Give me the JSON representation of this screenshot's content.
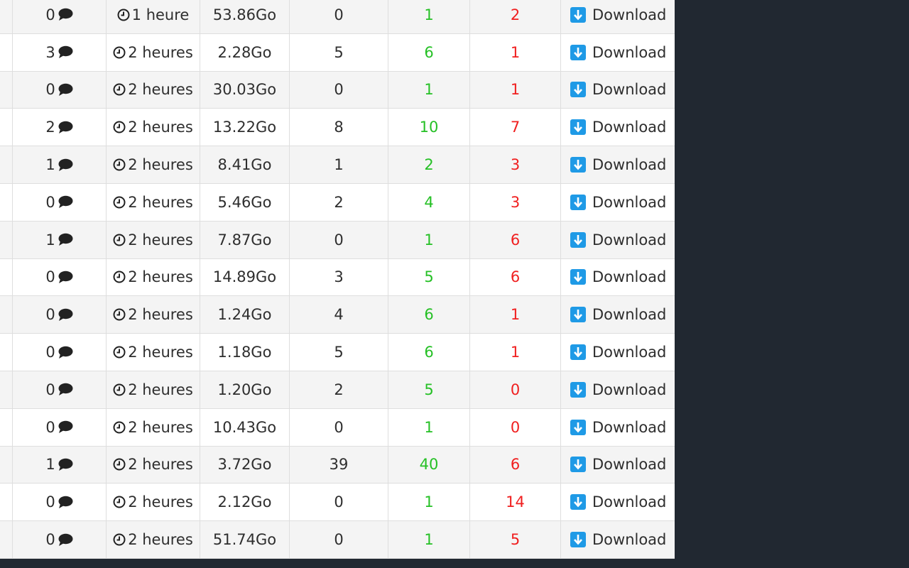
{
  "download_label": "Download",
  "colors": {
    "seeders": "#25c025",
    "leechers": "#f01f1f",
    "download_icon": "#1f9ae6",
    "side_panel": "#212831"
  },
  "icons": {
    "comments": "comment-icon",
    "age": "clock-icon",
    "download": "download-icon"
  },
  "rows": [
    {
      "comments": "0",
      "age": "1 heure",
      "size": "53.86Go",
      "completed": "0",
      "seeders": "1",
      "leechers": "2"
    },
    {
      "comments": "3",
      "age": "2 heures",
      "size": "2.28Go",
      "completed": "5",
      "seeders": "6",
      "leechers": "1"
    },
    {
      "comments": "0",
      "age": "2 heures",
      "size": "30.03Go",
      "completed": "0",
      "seeders": "1",
      "leechers": "1"
    },
    {
      "comments": "2",
      "age": "2 heures",
      "size": "13.22Go",
      "completed": "8",
      "seeders": "10",
      "leechers": "7"
    },
    {
      "comments": "1",
      "age": "2 heures",
      "size": "8.41Go",
      "completed": "1",
      "seeders": "2",
      "leechers": "3"
    },
    {
      "comments": "0",
      "age": "2 heures",
      "size": "5.46Go",
      "completed": "2",
      "seeders": "4",
      "leechers": "3"
    },
    {
      "comments": "1",
      "age": "2 heures",
      "size": "7.87Go",
      "completed": "0",
      "seeders": "1",
      "leechers": "6"
    },
    {
      "comments": "0",
      "age": "2 heures",
      "size": "14.89Go",
      "completed": "3",
      "seeders": "5",
      "leechers": "6"
    },
    {
      "comments": "0",
      "age": "2 heures",
      "size": "1.24Go",
      "completed": "4",
      "seeders": "6",
      "leechers": "1"
    },
    {
      "comments": "0",
      "age": "2 heures",
      "size": "1.18Go",
      "completed": "5",
      "seeders": "6",
      "leechers": "1"
    },
    {
      "comments": "0",
      "age": "2 heures",
      "size": "1.20Go",
      "completed": "2",
      "seeders": "5",
      "leechers": "0"
    },
    {
      "comments": "0",
      "age": "2 heures",
      "size": "10.43Go",
      "completed": "0",
      "seeders": "1",
      "leechers": "0"
    },
    {
      "comments": "1",
      "age": "2 heures",
      "size": "3.72Go",
      "completed": "39",
      "seeders": "40",
      "leechers": "6"
    },
    {
      "comments": "0",
      "age": "2 heures",
      "size": "2.12Go",
      "completed": "0",
      "seeders": "1",
      "leechers": "14"
    },
    {
      "comments": "0",
      "age": "2 heures",
      "size": "51.74Go",
      "completed": "0",
      "seeders": "1",
      "leechers": "5"
    }
  ]
}
